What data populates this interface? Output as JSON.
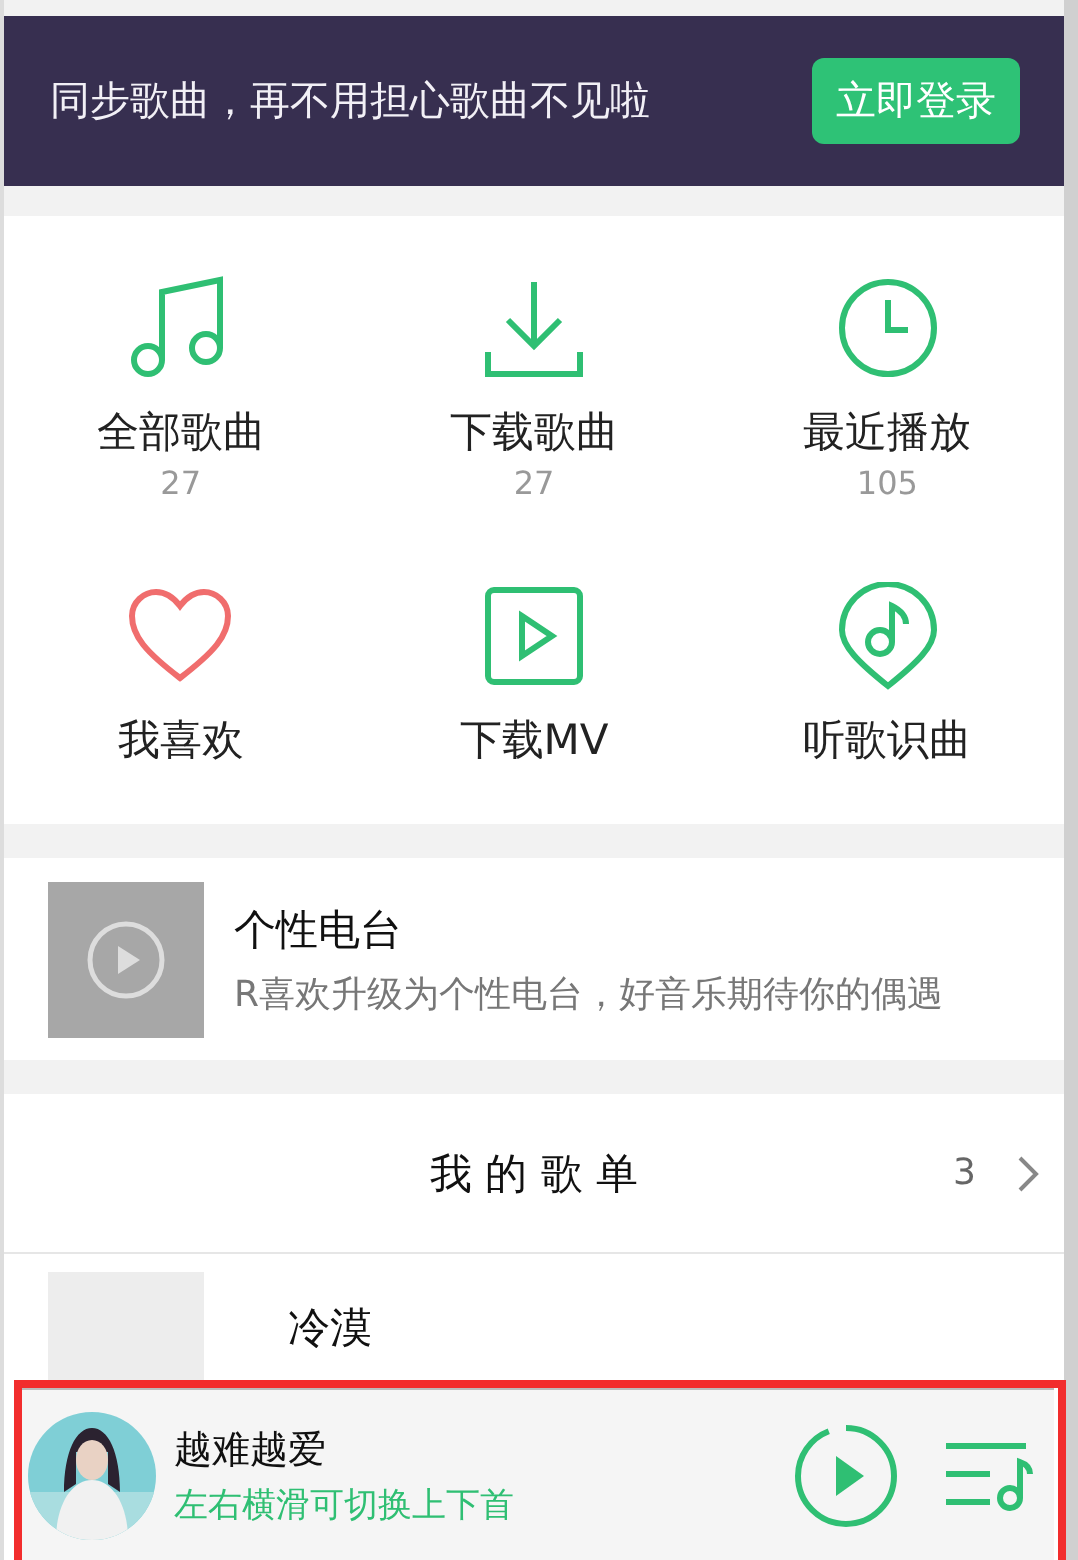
{
  "login_banner": {
    "message": "同步歌曲，再不用担心歌曲不见啦",
    "button": "立即登录"
  },
  "shortcuts": [
    {
      "kind": "all",
      "label": "全部歌曲",
      "count": "27"
    },
    {
      "kind": "download",
      "label": "下载歌曲",
      "count": "27"
    },
    {
      "kind": "recent",
      "label": "最近播放",
      "count": "105"
    },
    {
      "kind": "favorite",
      "label": "我喜欢"
    },
    {
      "kind": "mv",
      "label": "下载MV"
    },
    {
      "kind": "recognize",
      "label": "听歌识曲"
    }
  ],
  "radio": {
    "title": "个性电台",
    "subtitle": "R喜欢升级为个性电台，好音乐期待你的偶遇"
  },
  "playlists": {
    "title": "我 的 歌 单",
    "count": "3",
    "items": [
      {
        "name": "冷漠"
      }
    ]
  },
  "player": {
    "song": "越难越爱",
    "hint": "左右横滑可切换上下首",
    "level": 0.94
  }
}
